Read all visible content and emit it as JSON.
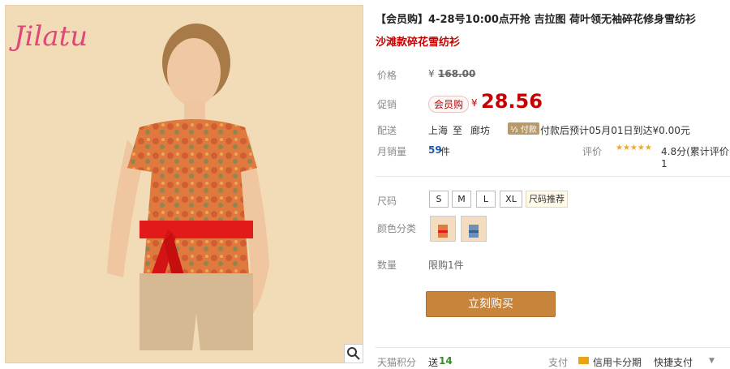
{
  "photo": {
    "logo": "Jilatu"
  },
  "product": {
    "title": "【会员购】4-28号10:00点开抢 吉拉图 荷叶领无袖碎花修身雪纺衫",
    "subtitle": "沙滩款碎花雪纺衫"
  },
  "price": {
    "label": "价格",
    "currency": "¥",
    "original": "168.00"
  },
  "promo": {
    "label": "促销",
    "badge": "会员购",
    "currency": "¥",
    "value": "28.56"
  },
  "shipping": {
    "label": "配送",
    "from": "上海",
    "to_word": "至",
    "to": "廊坊",
    "tag": "⅓ 付款",
    "text": "付款后预计05月01日到达¥0.00元"
  },
  "sales": {
    "label": "月销量",
    "count": "59",
    "unit": "件",
    "review_label": "评价",
    "stars": "★★★★★",
    "rating_text": "4.8分(累计评价1"
  },
  "size": {
    "label": "尺码",
    "options": [
      "S",
      "M",
      "L",
      "XL"
    ],
    "recommend": "尺码推荐"
  },
  "color": {
    "label": "颜色分类"
  },
  "quantity": {
    "label": "数量",
    "limit": "限购1件"
  },
  "buy_button": "立刻购买",
  "footer": {
    "points_label": "天猫积分",
    "points_prefix": "送",
    "points_value": "14",
    "pay_label": "支付",
    "pay_credit": "信用卡分期",
    "pay_quick": "快捷支付"
  }
}
